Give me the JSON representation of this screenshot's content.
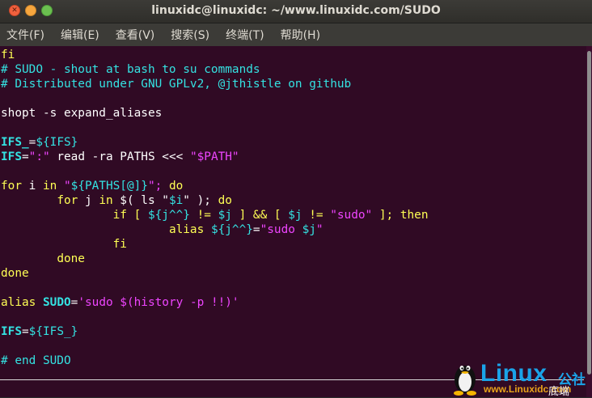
{
  "window": {
    "title": "linuxidc@linuxidc: ~/www.linuxidc.com/SUDO"
  },
  "menubar": {
    "items": [
      "文件(F)",
      "编辑(E)",
      "查看(V)",
      "搜索(S)",
      "终端(T)",
      "帮助(H)"
    ]
  },
  "code": {
    "l01": "fi",
    "l02": "# SUDO - shout at bash to su commands",
    "l03": "# Distributed under GNU GPLv2, @jthistle on github",
    "l05": "shopt -s expand_aliases",
    "l07a": "IFS_",
    "l07b": "=",
    "l07c": "${IFS}",
    "l08a": "IFS",
    "l08b": "=",
    "l08c": "\":\"",
    "l08d": " read -ra PATHS <<< ",
    "l08e": "\"$PATH\"",
    "l10a": "for",
    "l10b": " i ",
    "l10c": "in",
    "l10d": " \"",
    "l10e": "${PATHS[@]}",
    "l10f": "\"; ",
    "l10g": "do",
    "l11a": "        ",
    "l11b": "for",
    "l11c": " j ",
    "l11d": "in",
    "l11e": " $( ls \"",
    "l11f": "$i",
    "l11g": "\" ); ",
    "l11h": "do",
    "l12a": "                ",
    "l12b": "if",
    "l12c": " [ ",
    "l12d": "${j^^}",
    "l12e": " != ",
    "l12f": "$j",
    "l12g": " ] && [ ",
    "l12h": "$j",
    "l12i": " != ",
    "l12j": "\"sudo\"",
    "l12k": " ]; ",
    "l12l": "then",
    "l13a": "                        ",
    "l13b": "alias",
    "l13c": " ",
    "l13d": "${j^^}",
    "l13e": "=",
    "l13f": "\"sudo ",
    "l13g": "$j",
    "l13h": "\"",
    "l14a": "                ",
    "l14b": "fi",
    "l15a": "        ",
    "l15b": "done",
    "l16": "done",
    "l18a": "alias",
    "l18b": " ",
    "l18c": "SUDO",
    "l18d": "=",
    "l18e": "'sudo $(history -p !!)'",
    "l20a": "IFS",
    "l20b": "=",
    "l20c": "${IFS_}",
    "l22": "# end SUDO"
  },
  "watermark": {
    "brand": "Linux",
    "cn": "公社",
    "url": "www.Linuxidc.com",
    "overlay": "底端"
  },
  "colors": {
    "background": "#300a24",
    "keyword": "#ffff54",
    "comment": "#34e2e2",
    "string": "#ee45ff"
  }
}
